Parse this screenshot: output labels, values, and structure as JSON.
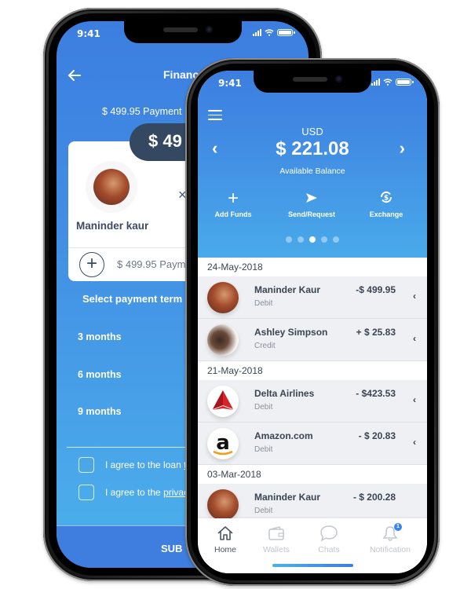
{
  "status_bar": {
    "time": "9:41"
  },
  "finance_screen": {
    "title": "Finance",
    "payment_summary": "$ 499.95 Payment",
    "amount_pill": "$ 49",
    "recipient": {
      "name": "Maninder kaur",
      "close_glyph": "×"
    },
    "card_amount": "$ 499.95 Paym",
    "add_glyph": "+",
    "select_term_label": "Select payment term",
    "terms": [
      "3 months",
      "6 months",
      "9 months"
    ],
    "agreements": [
      {
        "text": "I agree to the loan ",
        "link": "te"
      },
      {
        "text": "I agree to the ",
        "link": "privac"
      }
    ],
    "submit_label": "SUB"
  },
  "wallet_screen": {
    "currency": "USD",
    "balance": "$ 221.08",
    "balance_label": "Available Balance",
    "prev_glyph": "‹",
    "next_glyph": "›",
    "actions": [
      {
        "label": "Add Funds",
        "icon": "plus-icon",
        "glyph": "+"
      },
      {
        "label": "Send/Request",
        "icon": "send-icon",
        "glyph": "➤"
      },
      {
        "label": "Exchange",
        "icon": "exchange-icon",
        "glyph": "$"
      }
    ],
    "carousel": {
      "count": 5,
      "active_index": 2
    },
    "groups": [
      {
        "date": "24-May-2018",
        "transactions": [
          {
            "name": "Maninder Kaur",
            "type": "Debit",
            "amount": "-$ 499.95",
            "avatar": "woman1"
          },
          {
            "name": "Ashley Simpson",
            "type": "Credit",
            "amount": "+ $ 25.83",
            "avatar": "woman2"
          }
        ]
      },
      {
        "date": "21-May-2018",
        "transactions": [
          {
            "name": "Delta Airlines",
            "type": "Debit",
            "amount": "- $423.53",
            "avatar": "delta"
          },
          {
            "name": "Amazon.com",
            "type": "Debit",
            "amount": "- $ 20.83",
            "avatar": "amazon"
          }
        ]
      },
      {
        "date": "03-Mar-2018",
        "transactions": [
          {
            "name": "Maninder Kaur",
            "type": "Debit",
            "amount": "- $ 200.28",
            "avatar": "woman1"
          }
        ]
      }
    ],
    "row_chevron": "‹",
    "tabs": [
      {
        "label": "Home",
        "icon": "home-icon",
        "active": true
      },
      {
        "label": "Wallets",
        "icon": "wallet-icon",
        "active": false
      },
      {
        "label": "Chats",
        "icon": "chat-icon",
        "active": false
      },
      {
        "label": "Notification",
        "icon": "bell-icon",
        "active": false,
        "badge": "1"
      }
    ]
  },
  "colors": {
    "gradient_top": "#3c7ee0",
    "gradient_bottom": "#4ab0ec",
    "pill_dark": "#344862",
    "text_dark": "#3b4453",
    "accent": "#3a86e8"
  }
}
